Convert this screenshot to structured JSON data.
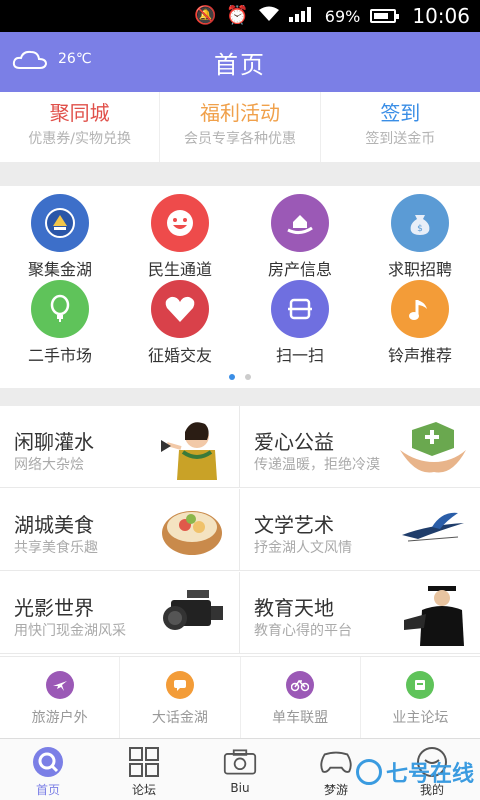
{
  "status_bar": {
    "battery": "69%",
    "time": "10:06"
  },
  "header": {
    "temperature": "26℃",
    "title": "首页"
  },
  "promo": [
    {
      "title": "聚同城",
      "subtitle": "优惠券/实物兑换",
      "color": "#e0504a"
    },
    {
      "title": "福利活动",
      "subtitle": "会员专享各种优惠",
      "color": "#f0a04a"
    },
    {
      "title": "签到",
      "subtitle": "签到送金币",
      "color": "#3a8ee6"
    }
  ],
  "grid": [
    {
      "label": "聚集金湖",
      "color": "#3d6fc9",
      "icon": "police-badge-icon"
    },
    {
      "label": "民生通道",
      "color": "#ee4b4b",
      "icon": "smiley-icon"
    },
    {
      "label": "房产信息",
      "color": "#9b59b6",
      "icon": "house-hand-icon"
    },
    {
      "label": "求职招聘",
      "color": "#5b9bd5",
      "icon": "money-bag-icon"
    },
    {
      "label": "二手市场",
      "color": "#5fc35a",
      "icon": "balloon-icon"
    },
    {
      "label": "征婚交友",
      "color": "#d9414a",
      "icon": "heart-icon"
    },
    {
      "label": "扫一扫",
      "color": "#6f6fe0",
      "icon": "scan-icon"
    },
    {
      "label": "铃声推荐",
      "color": "#f39c38",
      "icon": "music-note-icon"
    }
  ],
  "cards": [
    {
      "title": "闲聊灌水",
      "subtitle": "网络大杂烩",
      "picture": "shouting-woman"
    },
    {
      "title": "爱心公益",
      "subtitle": "传递温暖，拒绝冷漠",
      "picture": "hands-plant"
    },
    {
      "title": "湖城美食",
      "subtitle": "共享美食乐趣",
      "picture": "food-bowl"
    },
    {
      "title": "文学艺术",
      "subtitle": "抒金湖人文风情",
      "picture": "ink-brush"
    },
    {
      "title": "光影世界",
      "subtitle": "用快门现金湖风采",
      "picture": "video-camera"
    },
    {
      "title": "教育天地",
      "subtitle": "教育心得的平台",
      "picture": "graduate"
    }
  ],
  "forums": [
    {
      "label": "旅游户外",
      "color": "#9b59b6",
      "icon": "plane-icon"
    },
    {
      "label": "大话金湖",
      "color": "#f39c38",
      "icon": "chat-icon"
    },
    {
      "label": "单车联盟",
      "color": "#9b59b6",
      "icon": "bicycle-icon"
    },
    {
      "label": "业主论坛",
      "color": "#5fc35a",
      "icon": "board-icon"
    }
  ],
  "tabs": [
    {
      "label": "首页",
      "icon": "home-icon"
    },
    {
      "label": "论坛",
      "icon": "grid-icon"
    },
    {
      "label": "Biu",
      "icon": "camera-icon"
    },
    {
      "label": "梦游",
      "icon": "gamepad-icon"
    },
    {
      "label": "我的",
      "icon": "user-icon"
    }
  ],
  "watermark": "七号在线"
}
